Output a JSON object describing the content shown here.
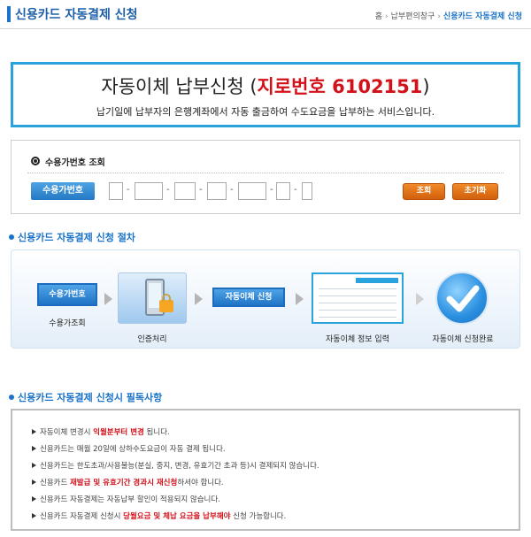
{
  "header": {
    "title": "신용카드 자동결제 신청",
    "breadcrumb": [
      "홈",
      "납부편의창구",
      "신용카드 자동결제 신청"
    ]
  },
  "banner": {
    "title_prefix": "자동이체 납부신청 (",
    "code": "지로번호 6102151",
    "title_suffix": ")",
    "subtitle": "납기일에 납부자의 은행계좌에서 자동 출금하여 수도요금을 납부하는 서비스입니다."
  },
  "lookup": {
    "title": "수용가번호 조회",
    "field_label": "수용가번호",
    "search_label": "조회",
    "reset_label": "초기화",
    "fields": [
      "",
      "",
      "",
      "",
      "",
      "",
      ""
    ]
  },
  "procedure": {
    "title": "신용카드 자동결제 신청 절차",
    "step1_button": "수용가번호",
    "step1_label": "수용가조회",
    "step2_label": "인증처리",
    "step3_button": "자동이체 신청",
    "step4_label": "자동이체 정보 입력",
    "step5_label": "자동이체 신청완료"
  },
  "notice": {
    "title": "신용카드 자동결제 신청시 필독사항",
    "items": [
      {
        "pre": "자동이체 변경시 ",
        "em": "익월분부터 변경",
        "post": " 됩니다."
      },
      {
        "pre": "신용카드는 매월 20일에 상하수도요금이 자동 결제 됩니다.",
        "em": "",
        "post": ""
      },
      {
        "pre": "신용카드는 한도초과/사용불능(분실, 중지, 변경, 유효기간 초과 등)시 결제되지 않습니다.",
        "em": "",
        "post": ""
      },
      {
        "pre": "신용카드 ",
        "em": "재발급 및 유효기간 경과시 재신청",
        "post": "하셔야 합니다."
      },
      {
        "pre": "신용카드 자동결제는 자동납부 할인이 적용되지 않습니다.",
        "em": "",
        "post": ""
      },
      {
        "pre": "신용카드 자동결제 신청시 ",
        "em": "당월요금 및 체납 요금을 납부해야",
        "post": " 신청 가능합니다."
      }
    ]
  },
  "colors": {
    "accent": "#1a73c9",
    "banner_border": "#2aa3dc",
    "highlight": "#d2111a",
    "button_orange": "#e0711a"
  },
  "icons": {
    "step_arrow": "chevron-right-icon",
    "auth": "phone-lock-icon",
    "form": "form-preview-icon",
    "done": "checkmark-icon"
  }
}
